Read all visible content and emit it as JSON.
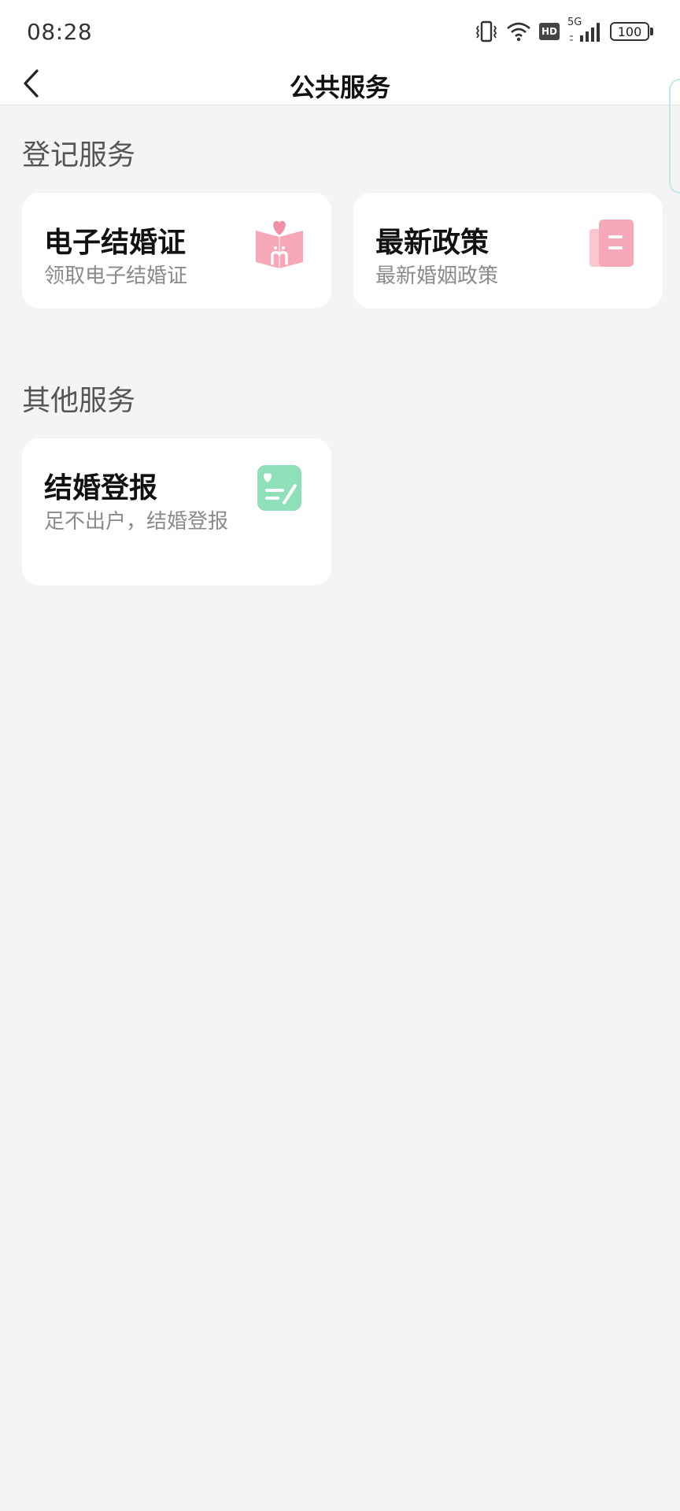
{
  "status_bar": {
    "time": "08:28",
    "network": "5G",
    "hd": "HD",
    "battery": "100"
  },
  "header": {
    "title": "公共服务"
  },
  "sections": [
    {
      "title": "登记服务",
      "cards": [
        {
          "title": "电子结婚证",
          "subtitle": "领取电子结婚证",
          "icon": "marriage-book-icon"
        },
        {
          "title": "最新政策",
          "subtitle": "最新婚姻政策",
          "icon": "document-icon"
        }
      ]
    },
    {
      "title": "其他服务",
      "cards": [
        {
          "title": "结婚登报",
          "subtitle": "足不出户，结婚登报",
          "icon": "notepad-heart-icon"
        }
      ]
    }
  ],
  "colors": {
    "pink": "#f7a8b8",
    "pink_dark": "#f291a4",
    "green": "#8ee0b8",
    "background": "#f4f4f4"
  }
}
